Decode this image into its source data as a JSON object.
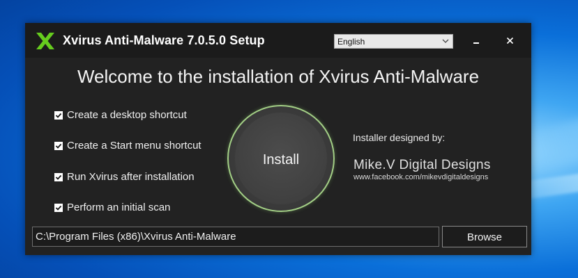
{
  "window": {
    "title": "Xvirus Anti-Malware 7.0.5.0 Setup",
    "logo_icon": "xvirus-x-logo",
    "language": {
      "selected": "English"
    }
  },
  "main": {
    "welcome": "Welcome to the installation of Xvirus Anti-Malware",
    "options": [
      {
        "label": "Create a desktop shortcut",
        "checked": true
      },
      {
        "label": "Create a Start menu shortcut",
        "checked": true
      },
      {
        "label": "Run Xvirus after installation",
        "checked": true
      },
      {
        "label": "Perform an initial scan",
        "checked": true
      }
    ],
    "install_label": "Install",
    "designer": {
      "caption": "Installer designed by:",
      "brand": "Mike.V Digital Designs",
      "url": "www.facebook.com/mikevdigitaldesigns"
    },
    "install_path": "C:\\Program Files (x86)\\Xvirus Anti-Malware",
    "browse_label": "Browse"
  },
  "colors": {
    "accent": "#66cc1e",
    "ring": "#a3cf86",
    "window_bg": "#222222"
  }
}
